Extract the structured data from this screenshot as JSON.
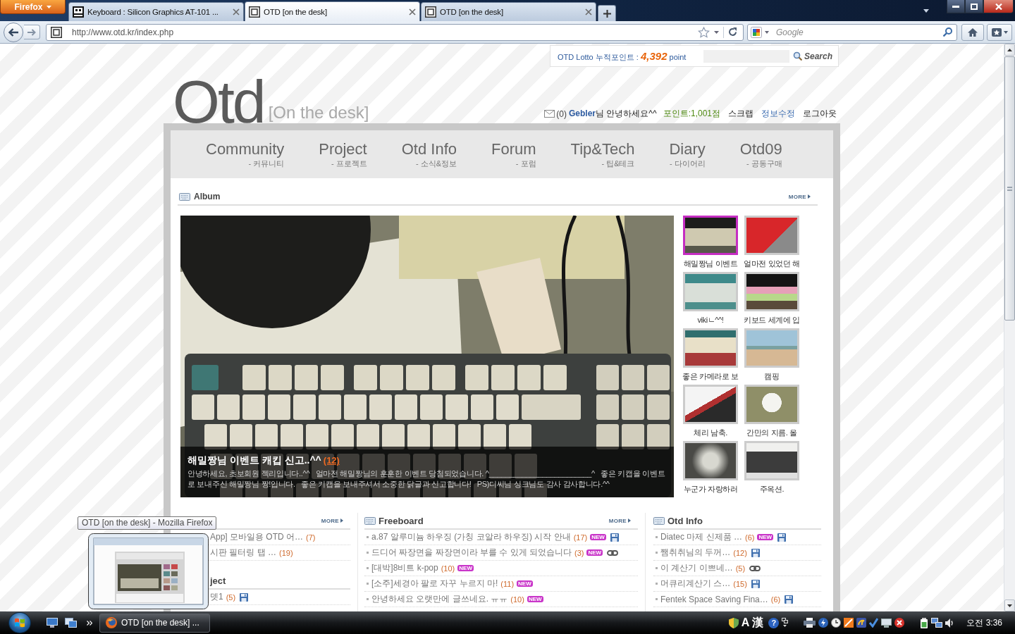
{
  "browser": {
    "app_button": "Firefox",
    "tabs": [
      {
        "kind": "keyboard",
        "title": "Keyboard : Silicon Graphics AT-101 ...",
        "selected": false
      },
      {
        "kind": "page",
        "title": "OTD [on the desk]",
        "selected": true
      },
      {
        "kind": "page",
        "title": "OTD [on the desk]",
        "selected": false
      }
    ],
    "url": "http://www.otd.kr/index.php",
    "search": {
      "placeholder": "Google"
    }
  },
  "page": {
    "lotto": {
      "text": "OTD Lotto 누적포인트 : **4,392** point",
      "search_button": "Search"
    },
    "logo": {
      "name": "Otd",
      "tagline": "[On the desk]"
    },
    "user_bar": {
      "messages": "(0)",
      "greeting": "**Gebler**님 안녕하세요^^",
      "points": "포인트:1,001점",
      "scrap": "스크랩",
      "edit_profile": "정보수정",
      "logout": "로그아웃"
    },
    "menu": [
      {
        "title": "Community",
        "subtitle": "- 커뮤니티"
      },
      {
        "title": "Project",
        "subtitle": "- 프로젝트"
      },
      {
        "title": "Otd Info",
        "subtitle": "- 소식&정보"
      },
      {
        "title": "Forum",
        "subtitle": "- 포럼"
      },
      {
        "title": "Tip&Tech",
        "subtitle": "- 팁&테크"
      },
      {
        "title": "Diary",
        "subtitle": "- 다이어리"
      },
      {
        "title": "Otd09",
        "subtitle": "- 공동구매"
      }
    ],
    "album": {
      "title": "Album",
      "more": "MORE",
      "featured": {
        "title": "해밀짱님 이벤트 캐킵 신고..^^",
        "comments": "(12)",
        "description": "안녕하세요, 초보회원 젝리입니다..^^   얼마전 해밀짱님의 훈훈한 이벤트 당첨되었습니다. ^_________________________^   좋은 키캡을 이벤트로 보내주신 해밀짱님 짱!입니다.   좋은 키캡을 보내주셔서 소중한 닭글과 신고합니다!   PS)디씨님 싱크님도 감사 감사합니다.^^"
      },
      "thumbnails": [
        {
          "caption": "해밀짱님 이벤트",
          "selected": true
        },
        {
          "caption": "얼마전 있었던 해",
          "selected": false
        },
        {
          "caption": "vikiㄴ^^!",
          "selected": false
        },
        {
          "caption": "키보드 세계에 입",
          "selected": false
        },
        {
          "caption": "좋은 카메라로 보",
          "selected": false
        },
        {
          "caption": "캠핑",
          "selected": false
        },
        {
          "caption": "체리 남축.",
          "selected": false
        },
        {
          "caption": "간만의 지름. 올",
          "selected": false
        },
        {
          "caption": "누군가 자랑하러",
          "selected": false
        },
        {
          "caption": "주옥션.",
          "selected": false
        }
      ]
    },
    "boards": [
      {
        "sections": [
          {
            "icon": false,
            "bullets": false,
            "more": "MORE",
            "items": [
              {
                "text": "App] 모바일용 OTD 어…",
                "count": "(7)",
                "file": false,
                "link": false
              },
              {
                "text": "시판 필터링 탭 …",
                "count": "(19)",
                "file": false,
                "link": false
              }
            ]
          },
          {
            "title": "ject",
            "icon": false,
            "bullets": false,
            "items": [
              {
                "text": "뎃1",
                "count": "(5)",
                "file": true,
                "link": false
              }
            ]
          }
        ]
      },
      {
        "sections": [
          {
            "title": "Freeboard",
            "icon": true,
            "bullets": true,
            "more": "MORE",
            "items": [
              {
                "text": "a.87 알루미늄 하우징 (가칭 코알라 하우징) 시작 안내",
                "count": "(17)",
                "badge": "NEW",
                "file": true,
                "link": false
              },
              {
                "text": "드디어 짜장면을 짜장면이라 부를 수 있게 되었습니다",
                "count": "(3)",
                "badge": "NEW",
                "file": false,
                "link": true
              },
              {
                "text": "[대박]8비트 k-pop",
                "count": "(10)",
                "badge": "NEW",
                "file": false,
                "link": false
              },
              {
                "text": "[소주]세경아 팔로 자꾸 누르지 마!",
                "count": "(11)",
                "badge": "NEW",
                "file": false,
                "link": false
              },
              {
                "text": "안녕하세요 오랫만에 글쓰네요. ㅠㅠ",
                "count": "(10)",
                "badge": "NEW",
                "file": false,
                "link": false
              }
            ]
          }
        ]
      },
      {
        "sections": [
          {
            "title": "Otd Info",
            "icon": true,
            "bullets": true,
            "items": [
              {
                "text": "Diatec 마제 신제품 …",
                "count": "(6)",
                "badge": "NEW",
                "file": true,
                "link": false
              },
              {
                "text": "쨈취취님의 두꺼…",
                "count": "(12)",
                "file": true,
                "link": false
              },
              {
                "text": "이 계산기 이쁘네…",
                "count": "(5)",
                "file": false,
                "link": true
              },
              {
                "text": "머큐리계산기 스…",
                "count": "(15)",
                "file": true,
                "link": false
              },
              {
                "text": "Fentek Space Saving Fina…",
                "count": "(6)",
                "file": true,
                "link": false
              }
            ]
          }
        ]
      }
    ]
  },
  "overlay": {
    "tooltip": "OTD [on the desk] - Mozilla Firefox"
  },
  "taskbar": {
    "window_button": "OTD [on the desk] ...",
    "language_bar": [
      "A",
      "漢"
    ],
    "help": "?",
    "clock": "오전 3:36"
  }
}
